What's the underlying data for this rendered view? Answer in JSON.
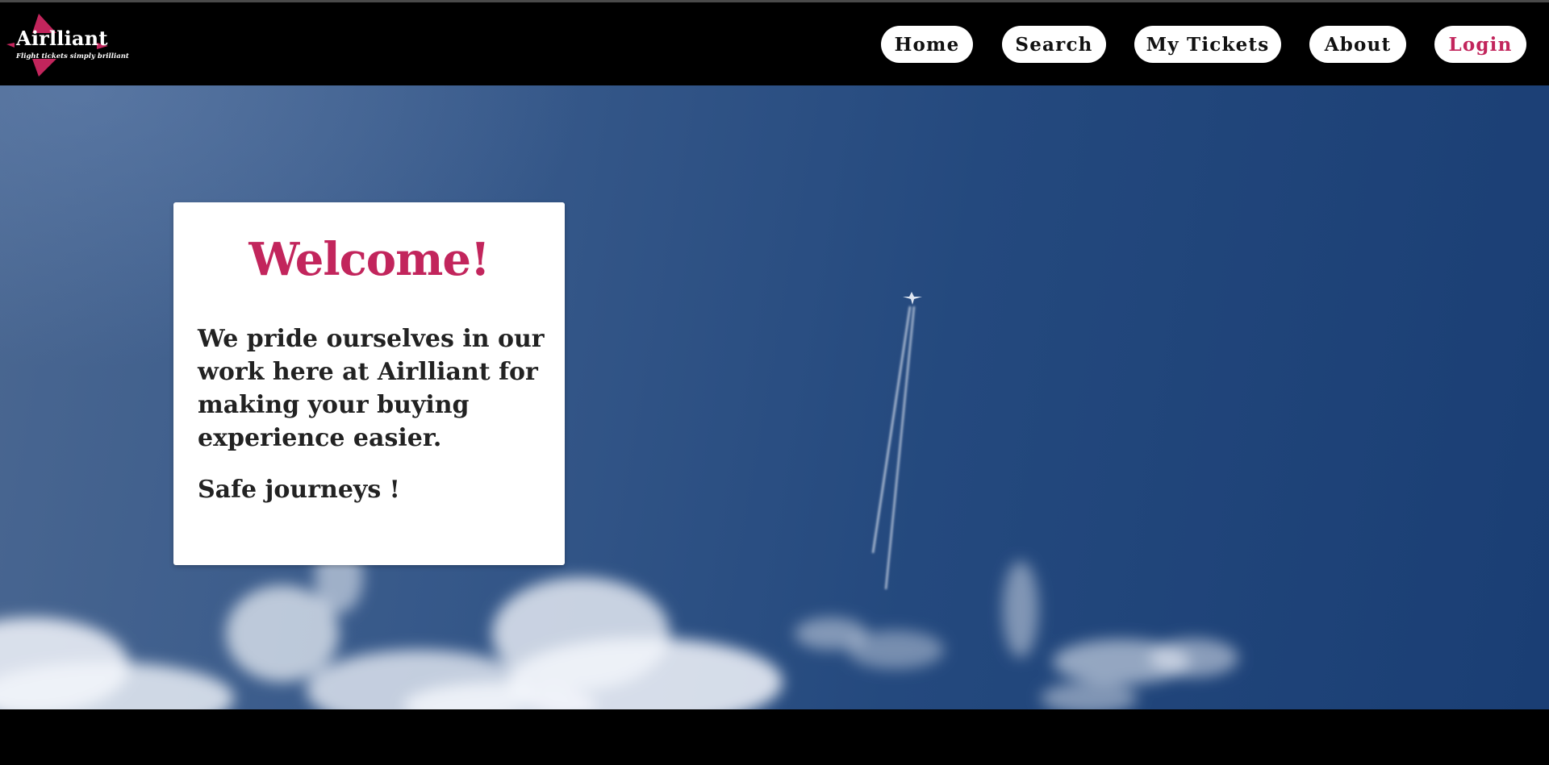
{
  "brand": {
    "name": "Airlliant",
    "tagline": "Flight tickets simply brilliant",
    "accent_color": "#c2255c"
  },
  "nav": {
    "items": [
      {
        "label": "Home"
      },
      {
        "label": "Search"
      },
      {
        "label": "My Tickets"
      },
      {
        "label": "About"
      },
      {
        "label": "Login"
      }
    ]
  },
  "welcome": {
    "title": "Welcome!",
    "body": "We pride ourselves in our work here at Airlliant for making your buying experience easier.",
    "closing": "Safe journeys !"
  },
  "hero": {
    "image": "sky-with-airplane-contrail",
    "colors": {
      "sky": "#24497e",
      "clouds": "#ffffff"
    }
  }
}
